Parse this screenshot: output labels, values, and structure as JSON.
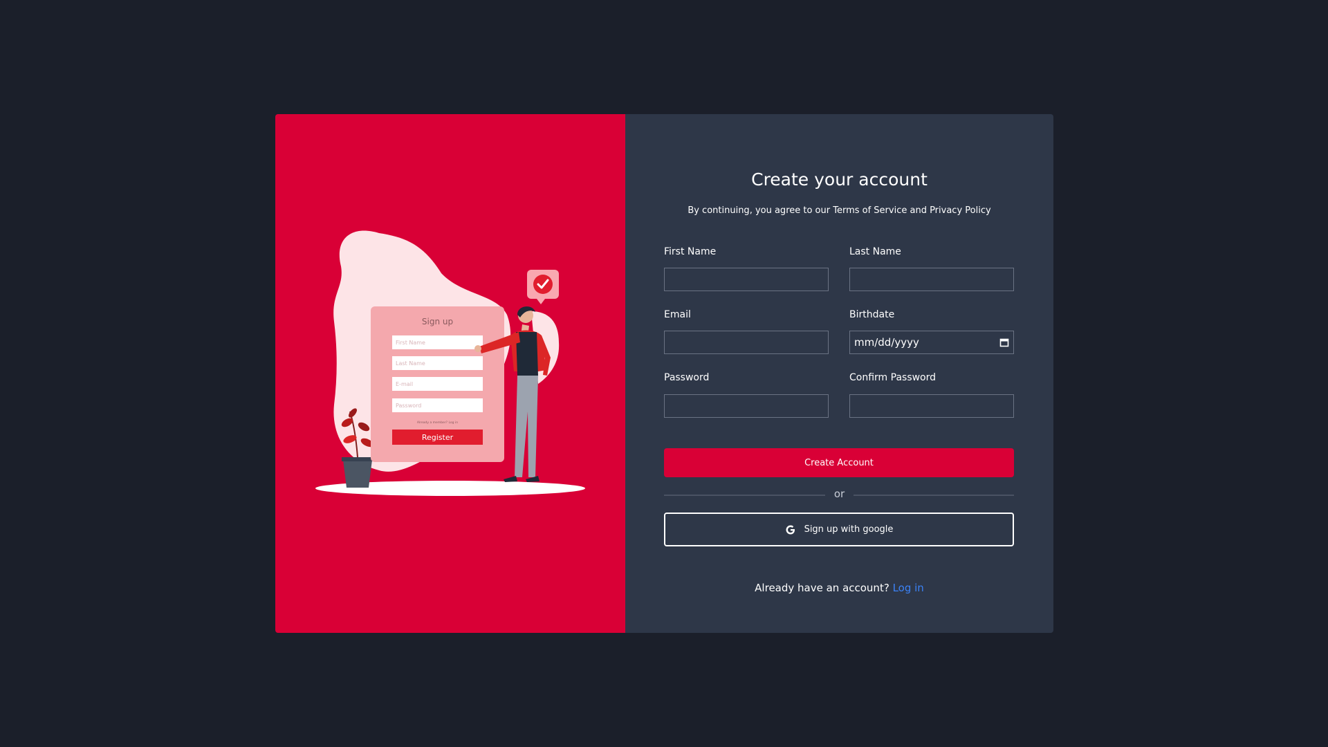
{
  "colors": {
    "page_background": "#1b1f2a",
    "accent": "#d90036",
    "form_panel": "#2e3748",
    "link": "#3b82f6"
  },
  "illustration": {
    "card_title": "Sign up",
    "fields": [
      "First Name",
      "Last Name",
      "E-mail",
      "Password"
    ],
    "login_hint": "Already a member? Log in",
    "register_label": "Register",
    "icons": [
      "check-badge-icon",
      "plant-icon",
      "person-figure"
    ]
  },
  "form": {
    "title": "Create your account",
    "terms": "By continuing, you agree to our Terms of Service and Privacy Policy",
    "first_name": {
      "label": "First Name",
      "value": ""
    },
    "last_name": {
      "label": "Last Name",
      "value": ""
    },
    "email": {
      "label": "Email",
      "value": ""
    },
    "birthdate": {
      "label": "Birthdate",
      "placeholder": "mm/dd/yyyy"
    },
    "password": {
      "label": "Password",
      "value": ""
    },
    "confirm_password": {
      "label": "Confirm Password",
      "value": ""
    },
    "create_button": "Create Account",
    "divider_text": "or",
    "google_button": "Sign up with google",
    "google_icon": "google-g-icon",
    "login_prompt": "Already have an account?",
    "login_link": "Log in"
  }
}
